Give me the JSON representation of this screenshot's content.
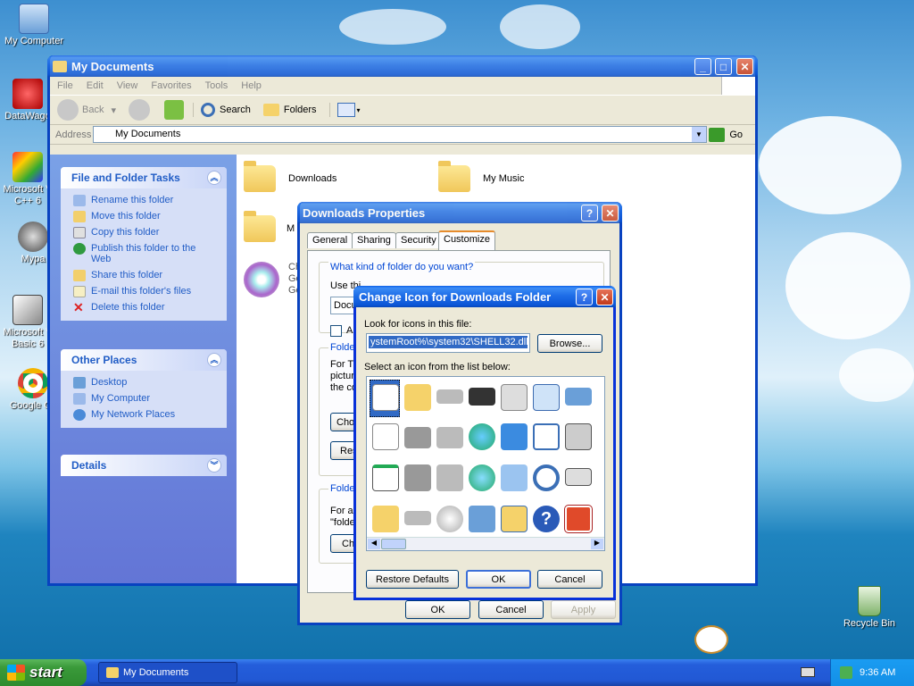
{
  "desktop": {
    "icons": [
      "My Computer",
      "DataWago",
      "Microsoft V C++ 6",
      "Mypa",
      "Microsoft V Basic 6",
      "Google Ch",
      "Recycle Bin"
    ]
  },
  "explorer": {
    "title": "My Documents",
    "menu": [
      "File",
      "Edit",
      "View",
      "Favorites",
      "Tools",
      "Help"
    ],
    "toolbar": {
      "back": "Back",
      "search": "Search",
      "folders": "Folders"
    },
    "address_label": "Address",
    "address_value": "My Documents",
    "go": "Go",
    "tasks_title": "File and Folder Tasks",
    "tasks": [
      "Rename this folder",
      "Move this folder",
      "Copy this folder",
      "Publish this folder to the Web",
      "Share this folder",
      "E-mail this folder's files",
      "Delete this folder"
    ],
    "places_title": "Other Places",
    "places": [
      "Desktop",
      "My Computer",
      "My Network Places"
    ],
    "details_title": "Details",
    "items": [
      "Downloads",
      "My Music",
      "M",
      "Ch",
      "Go",
      "Go"
    ]
  },
  "properties": {
    "title": "Downloads Properties",
    "tabs": [
      "General",
      "Sharing",
      "Security",
      "Customize"
    ],
    "q": "What kind of folder do you want?",
    "use": "Use thi",
    "docu": "Docu",
    "als": "Als",
    "folder1": "Folder",
    "fortext": [
      "For Th",
      "pictur",
      "the co"
    ],
    "choose": "Choo",
    "res": "Res",
    "folder2": "Folder",
    "forall": [
      "For all",
      "\"folde"
    ],
    "cha": "Cha",
    "ok": "OK",
    "cancel": "Cancel",
    "apply": "Apply"
  },
  "change_icon": {
    "title": "Change Icon for Downloads Folder",
    "look_label": "Look for icons in this file:",
    "path": "ystemRoot%\\system32\\SHELL32.dll",
    "browse": "Browse...",
    "select_label": "Select an icon from the list below:",
    "restore": "Restore Defaults",
    "ok": "OK",
    "cancel": "Cancel"
  },
  "taskbar": {
    "start": "start",
    "task": "My Documents",
    "time": "9:36 AM"
  }
}
